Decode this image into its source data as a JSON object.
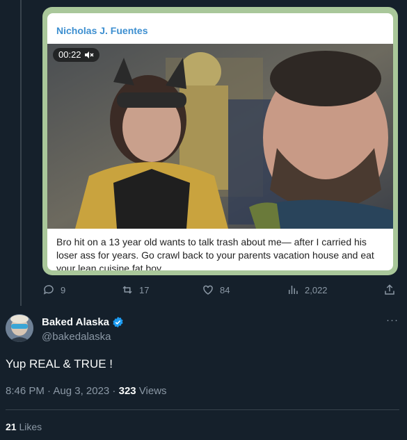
{
  "quoted_post": {
    "author": "Nicholas J. Fuentes",
    "video_time": "00:22",
    "caption": "Bro hit on a 13 year old wants to talk trash about me— after I carried his loser ass for years. Go crawl back to your parents vacation house and eat your lean cuisine fat boy."
  },
  "parent_actions": {
    "replies": "9",
    "reposts": "17",
    "likes": "84",
    "views": "2,022"
  },
  "tweet": {
    "display_name": "Baked Alaska",
    "handle": "@bakedalaska",
    "text": "Yup REAL & TRUE !",
    "time": "8:46 PM · Aug 3, 2023 · ",
    "views_count": "323",
    "views_label": " Views",
    "likes_count": "21",
    "likes_label": " Likes"
  },
  "colors": {
    "background": "#15202b",
    "secondary_text": "#8b98a5",
    "verified": "#1d9bf0",
    "telegram_name": "#3d8fd0"
  }
}
